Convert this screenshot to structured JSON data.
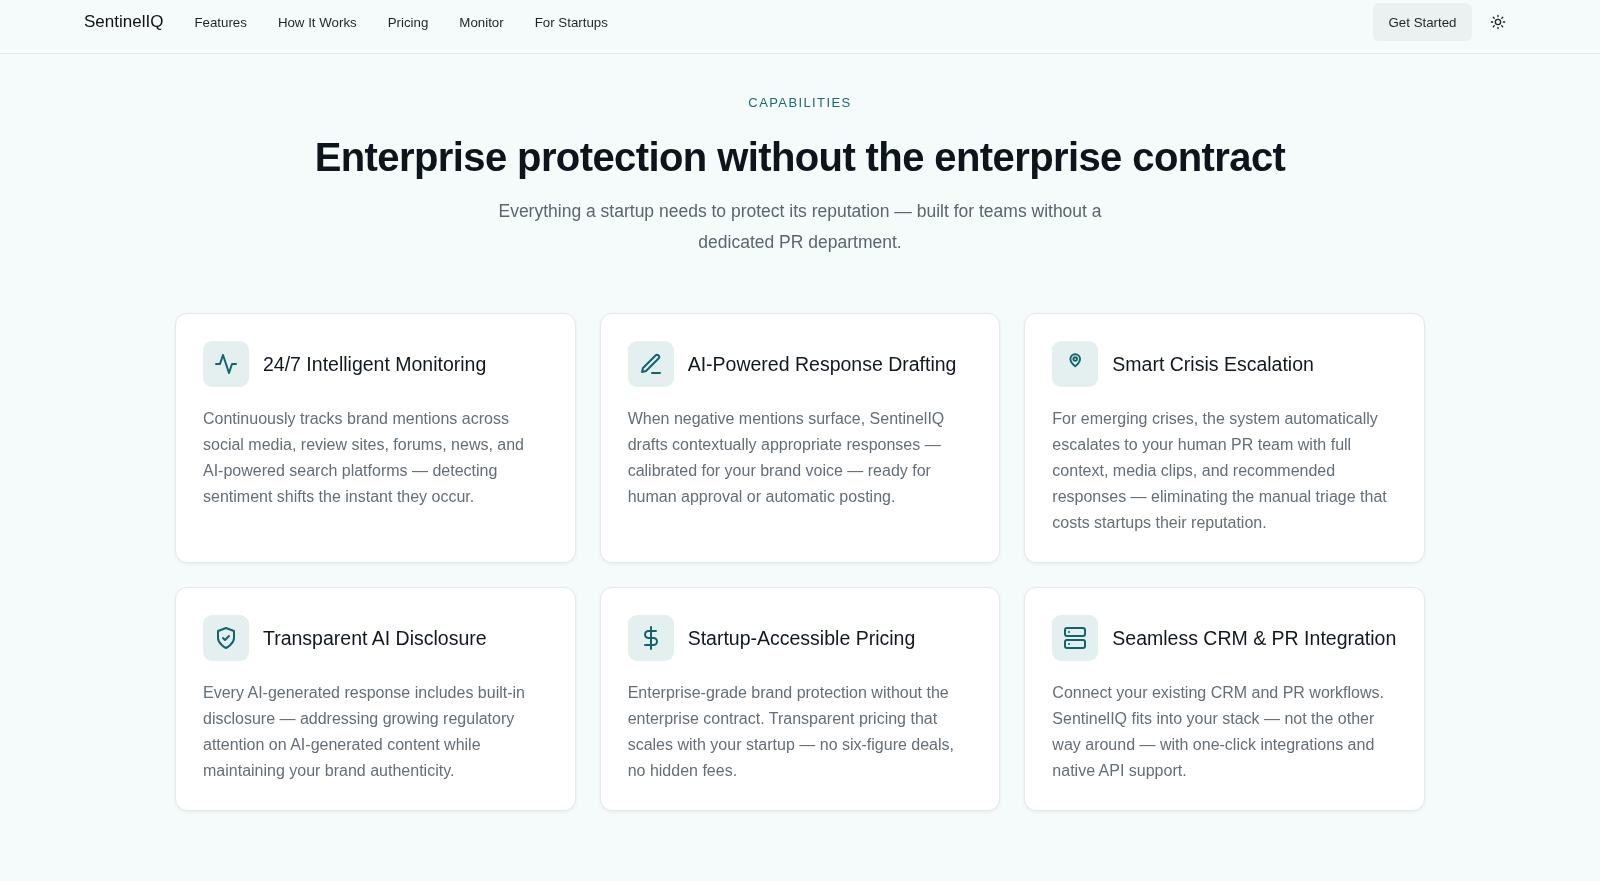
{
  "nav": {
    "logo": "SentinelIQ",
    "links": [
      "Features",
      "How It Works",
      "Pricing",
      "Monitor",
      "For Startups"
    ],
    "cta": "Get Started"
  },
  "section": {
    "eyebrow": "CAPABILITIES",
    "title": "Enterprise protection without the enterprise contract",
    "subtitle": "Everything a startup needs to protect its reputation — built for teams without a dedicated PR department."
  },
  "features": [
    {
      "kind": "pulse",
      "title": "24/7 Intelligent Monitoring",
      "description": "Continuously tracks brand mentions across social media, review sites, forums, news, and AI-powered search platforms — detecting sentiment shifts the instant they occur."
    },
    {
      "kind": "pen",
      "title": "AI-Powered Response Drafting",
      "description": "When negative mentions surface, SentinelIQ drafts contextually appropriate responses — calibrated for your brand voice — ready for human approval or automatic posting."
    },
    {
      "kind": "pin",
      "title": "Smart Crisis Escalation",
      "description": "For emerging crises, the system automatically escalates to your human PR team with full context, media clips, and recommended responses — eliminating the manual triage that costs startups their reputation."
    },
    {
      "kind": "shield",
      "title": "Transparent AI Disclosure",
      "description": "Every AI-generated response includes built-in disclosure — addressing growing regulatory attention on AI-generated content while maintaining your brand authenticity."
    },
    {
      "kind": "dollar",
      "title": "Startup-Accessible Pricing",
      "description": "Enterprise-grade brand protection without the enterprise contract. Transparent pricing that scales with your startup — no six-figure deals, no hidden fees."
    },
    {
      "kind": "server",
      "title": "Seamless CRM & PR Integration",
      "description": "Connect your existing CRM and PR workflows. SentinelIQ fits into your stack — not the other way around — with one-click integrations and native API support."
    }
  ]
}
